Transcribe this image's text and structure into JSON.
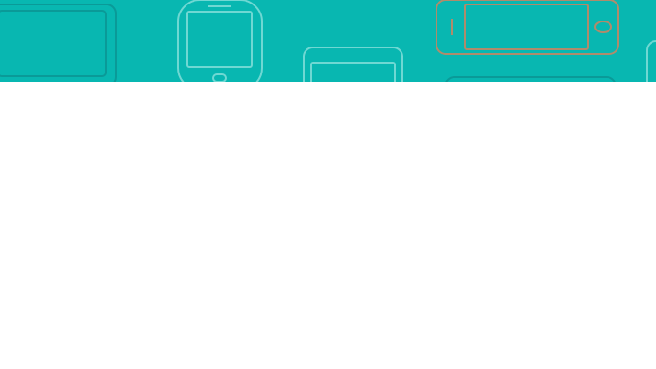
{
  "banner": {
    "background_color": "#08b7b1",
    "light_outline_color": "#6fd8d3",
    "dark_outline_color": "#0a9a98",
    "accent_outline_color": "#b08b6b",
    "icons": [
      "tablet-landscape-icon",
      "phone-portrait-icon",
      "small-tablet-icon",
      "smartphone-landscape-icon",
      "tablet-partial-icon"
    ]
  },
  "content": {
    "background_color": "#ffffff"
  }
}
